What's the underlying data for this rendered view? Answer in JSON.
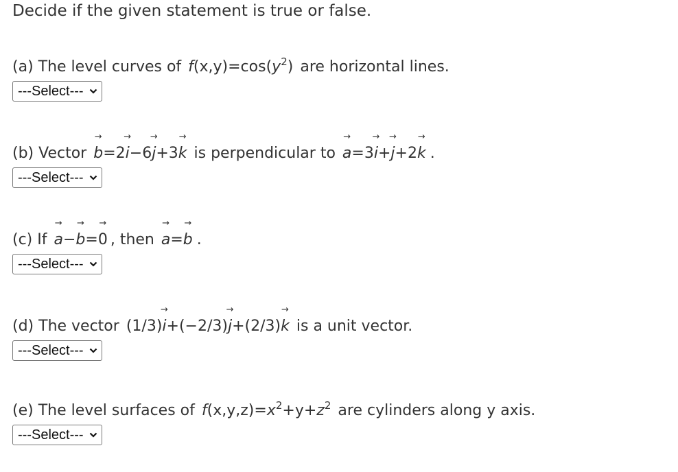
{
  "instruction": "Decide if the given statement is true or false.",
  "questions": [
    {
      "label": "(a) The level curves of",
      "math": {
        "f": "f",
        "args": "(x,y)",
        "eq": "=cos(",
        "var": "y",
        "exp": "2",
        "close": ")"
      },
      "suffix": "are horizontal lines.",
      "select": "---Select---"
    },
    {
      "label": "(b) Vector",
      "b": {
        "v": "b",
        "eq": "=2",
        "i": "i",
        "m1": "−6",
        "j": "j",
        "p1": "+3",
        "k": "k"
      },
      "mid": "is perpendicular to",
      "a": {
        "v": "a",
        "eq": "=3",
        "i": "i",
        "p1": "+",
        "j": "j",
        "p2": "+2",
        "k": "k"
      },
      "suffix": ".",
      "select": "---Select---"
    },
    {
      "label": "(c) If",
      "lhs": {
        "a": "a",
        "minus": "−",
        "b": "b",
        "eq": "=",
        "zero": "0"
      },
      "mid": ", then",
      "rhs": {
        "a": "a",
        "eq": "=",
        "b": "b"
      },
      "suffix": ".",
      "select": "---Select---"
    },
    {
      "label": "(d) The vector",
      "expr": {
        "c1": "(1/3)",
        "i": "i",
        "c2": "+(−2/3)",
        "j": "j",
        "c3": "+(2/3)",
        "k": "k"
      },
      "suffix": "is a unit vector.",
      "select": "---Select---"
    },
    {
      "label": "(e) The level surfaces of",
      "math": {
        "f": "f",
        "args": "(x,y,z)",
        "eq": "=",
        "x": "x",
        "exp1": "2",
        "plus": "+y+",
        "z": "z",
        "exp2": "2"
      },
      "suffix": "are cylinders along y axis.",
      "select": "---Select---"
    }
  ],
  "icons": {
    "arrow": "→",
    "chevron": "chevron-down-icon"
  }
}
